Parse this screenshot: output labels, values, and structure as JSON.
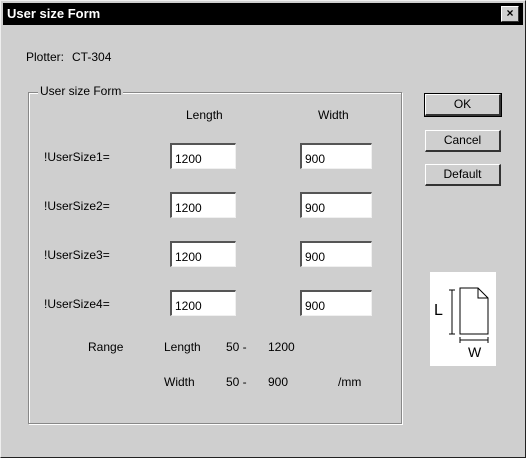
{
  "window": {
    "title": "User size Form",
    "close_glyph": "×"
  },
  "plotter": {
    "label": "Plotter:",
    "value": "CT-304"
  },
  "group": {
    "label": "User size Form",
    "col_length": "Length",
    "col_width": "Width",
    "rows": [
      {
        "label": "!UserSize1=",
        "length": "1200",
        "width": "900"
      },
      {
        "label": "!UserSize2=",
        "length": "1200",
        "width": "900"
      },
      {
        "label": "!UserSize3=",
        "length": "1200",
        "width": "900"
      },
      {
        "label": "!UserSize4=",
        "length": "1200",
        "width": "900"
      }
    ],
    "range": {
      "label": "Range",
      "length_label": "Length",
      "length_min": "50 -",
      "length_max": "1200",
      "width_label": "Width",
      "width_min": "50 -",
      "width_max": "900",
      "unit": "/mm"
    }
  },
  "buttons": {
    "ok": "OK",
    "cancel": "Cancel",
    "default": "Default"
  },
  "diagram": {
    "l_label": "L",
    "w_label": "W",
    "icon": "paper-size-diagram-icon"
  }
}
